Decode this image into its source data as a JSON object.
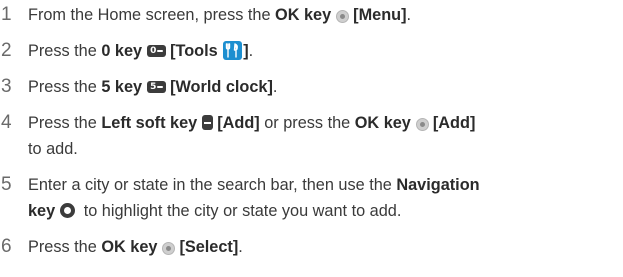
{
  "steps": [
    {
      "num": "1",
      "a": "From the Home screen, press the ",
      "b1": "OK key",
      "k1": "[Menu]",
      "end": "."
    },
    {
      "num": "2",
      "a": "Press the ",
      "b1": "0 key",
      "k1": "[Tools ",
      "k1end": "]",
      "end": "."
    },
    {
      "num": "3",
      "a": "Press the ",
      "b1": "5 key",
      "k1": "[World clock]",
      "end": "."
    },
    {
      "num": "4",
      "a": "Press the ",
      "b1": "Left soft key",
      "k1": "[Add]",
      "mid": " or press the ",
      "b2": "OK key",
      "k2": "[Add]",
      "line2": "to add."
    },
    {
      "num": "5",
      "a": "Enter a city or state in the search bar, then use the ",
      "b1": "Navigation",
      "b1line2": "key",
      "rest": " to highlight the city or state you want to add."
    },
    {
      "num": "6",
      "a": "Press the ",
      "b1": "OK key",
      "k1": "[Select]",
      "end": "."
    }
  ],
  "icons": {
    "ok_key": "ok-key-icon",
    "zero_key": "zero-key-icon",
    "tools": "tools-icon",
    "five_key": "five-key-icon",
    "left_soft_key": "left-soft-key-icon",
    "navigation_key": "navigation-key-icon"
  },
  "key_glyphs": {
    "zero": "0",
    "five": "5"
  },
  "colors": {
    "text": "#3a3a3a",
    "tools_icon": "#1d8fd0",
    "key": "#3c3c3c"
  }
}
